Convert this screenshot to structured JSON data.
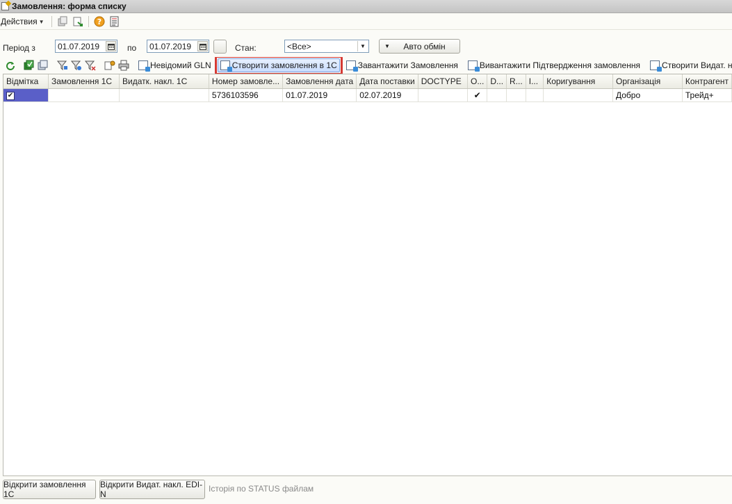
{
  "window": {
    "title": "Замовлення: форма списку"
  },
  "menu": {
    "actions_label": "Действия"
  },
  "filters": {
    "period_from_label": "Період з",
    "period_from_value": "01.07.2019",
    "to_label": "по",
    "period_to_value": "01.07.2019",
    "state_label": "Стан:",
    "state_value": "<Все>",
    "auto_exchange_label": "Авто обмін"
  },
  "toolbar": {
    "unknown_gln": "Невідомий GLN",
    "create_order_1c": "Створити замовлення в 1С",
    "load_orders": "Завантажити Замовлення",
    "upload_confirmation": "Вивантажити Підтвердження замовлення",
    "create_invoice": "Створити Видат. накл."
  },
  "table": {
    "columns": [
      "Відмітка",
      "Замовлення 1С",
      "Видатк. накл. 1С",
      "Номер замовле...",
      "Замовлення дата",
      "Дата поставки",
      "DOCTYPE",
      "О...",
      "D...",
      "R...",
      "I...",
      "Коригування",
      "Організація",
      "Контрагент"
    ],
    "rows": [
      {
        "mark": "✔",
        "order_1c": "",
        "invoice_1c": "",
        "order_number": "5736103596",
        "order_date": "01.07.2019",
        "delivery_date": "02.07.2019",
        "doctype": "",
        "o": "✔",
        "d": "",
        "r": "",
        "i": "",
        "correction": "",
        "organization": "Добро",
        "counterparty": "Трейд+"
      }
    ]
  },
  "bottom": {
    "open_order_1c": "Відкрити замовлення 1С",
    "open_invoice_edi": "Відкрити Видат. накл. EDI-N",
    "status_history": "Історія по STATUS файлам"
  },
  "colors": {
    "highlight_border": "#d63a34",
    "selection": "#5a5fc8"
  }
}
